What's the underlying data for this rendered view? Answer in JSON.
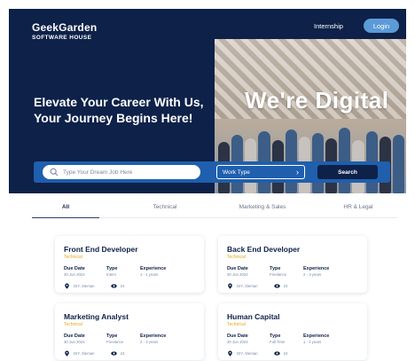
{
  "header": {
    "logo_name": "GeekGarden",
    "logo_subtitle": "SOFTWARE HOUSE",
    "nav_internship": "Internship",
    "login_label": "Login"
  },
  "hero": {
    "title_line1": "Elevate Your Career With Us,",
    "title_line2": "Your Journey Begins Here!",
    "photo_text": "We're Digital"
  },
  "search": {
    "placeholder": "Type Your Dream Job Here",
    "work_type_label": "Work Type",
    "button_label": "Search"
  },
  "tabs": [
    {
      "label": "All",
      "active": true
    },
    {
      "label": "Technical",
      "active": false
    },
    {
      "label": "Marketing & Sales",
      "active": false
    },
    {
      "label": "HR & Legal",
      "active": false
    }
  ],
  "jobs": [
    {
      "title": "Front End Developer",
      "category": "Technical",
      "due_label": "Due Date",
      "due_value": "30 Jun 2024",
      "type_label": "Type",
      "type_value": "Intern",
      "exp_label": "Experience",
      "exp_value": "1 - 1 years",
      "location": "DIY, Sleman",
      "views": "24"
    },
    {
      "title": "Back End Developer",
      "category": "Technical",
      "due_label": "Due Date",
      "due_value": "30 Jun 2024",
      "type_label": "Type",
      "type_value": "Freelance",
      "exp_label": "Experience",
      "exp_value": "2 - 3 years",
      "location": "DIY, Sleman",
      "views": "24"
    },
    {
      "title": "Marketing Analyst",
      "category": "Technical",
      "due_label": "Due Date",
      "due_value": "30 Jun 2024",
      "type_label": "Type",
      "type_value": "Freelance",
      "exp_label": "Experience",
      "exp_value": "2 - 3 years",
      "location": "DIY, Sleman",
      "views": "24"
    },
    {
      "title": "Human Capital",
      "category": "Technical",
      "due_label": "Due Date",
      "due_value": "30 Jun 2024",
      "type_label": "Type",
      "type_value": "Full Time",
      "exp_label": "Experience",
      "exp_value": "1 - 2 years",
      "location": "DIY, Sleman",
      "views": "24"
    }
  ],
  "colors": {
    "navy": "#0d2149",
    "accent_blue": "#1f5fae",
    "login_blue": "#5b9bd8",
    "category_yellow": "#e3a919"
  }
}
